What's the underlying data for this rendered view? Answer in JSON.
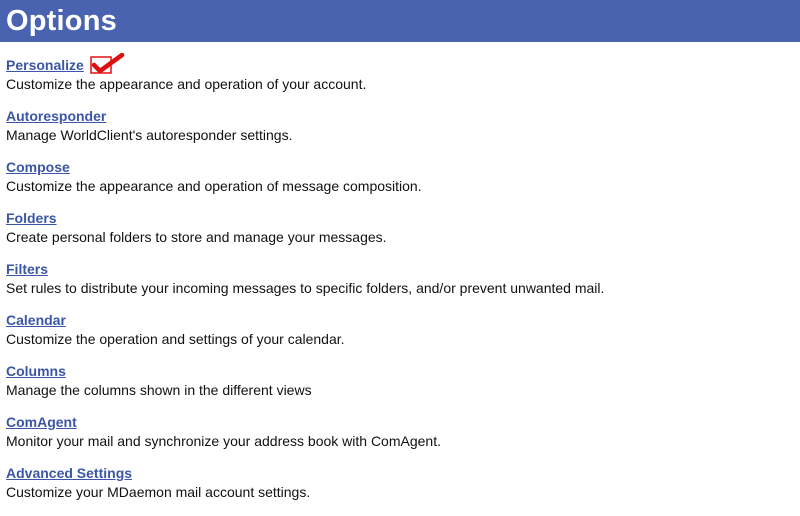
{
  "header": {
    "title": "Options",
    "background_color": "#4a63b0"
  },
  "options": [
    {
      "label": "Personalize",
      "description": "Customize the appearance and operation of your account.",
      "marked": true
    },
    {
      "label": "Autoresponder",
      "description": "Manage WorldClient's autoresponder settings."
    },
    {
      "label": "Compose",
      "description": "Customize the appearance and operation of message composition."
    },
    {
      "label": "Folders",
      "description": "Create personal folders to store and manage your messages."
    },
    {
      "label": "Filters",
      "description": "Set rules to distribute your incoming messages to specific folders, and/or prevent unwanted mail."
    },
    {
      "label": "Calendar",
      "description": "Customize the operation and settings of your calendar."
    },
    {
      "label": "Columns",
      "description": "Manage the columns shown in the different views"
    },
    {
      "label": "ComAgent",
      "description": "Monitor your mail and synchronize your address book with ComAgent."
    },
    {
      "label": "Advanced Settings",
      "description": "Customize your MDaemon mail account settings."
    }
  ],
  "colors": {
    "link": "#3b56a6",
    "annotation_mark": "#e01010"
  }
}
